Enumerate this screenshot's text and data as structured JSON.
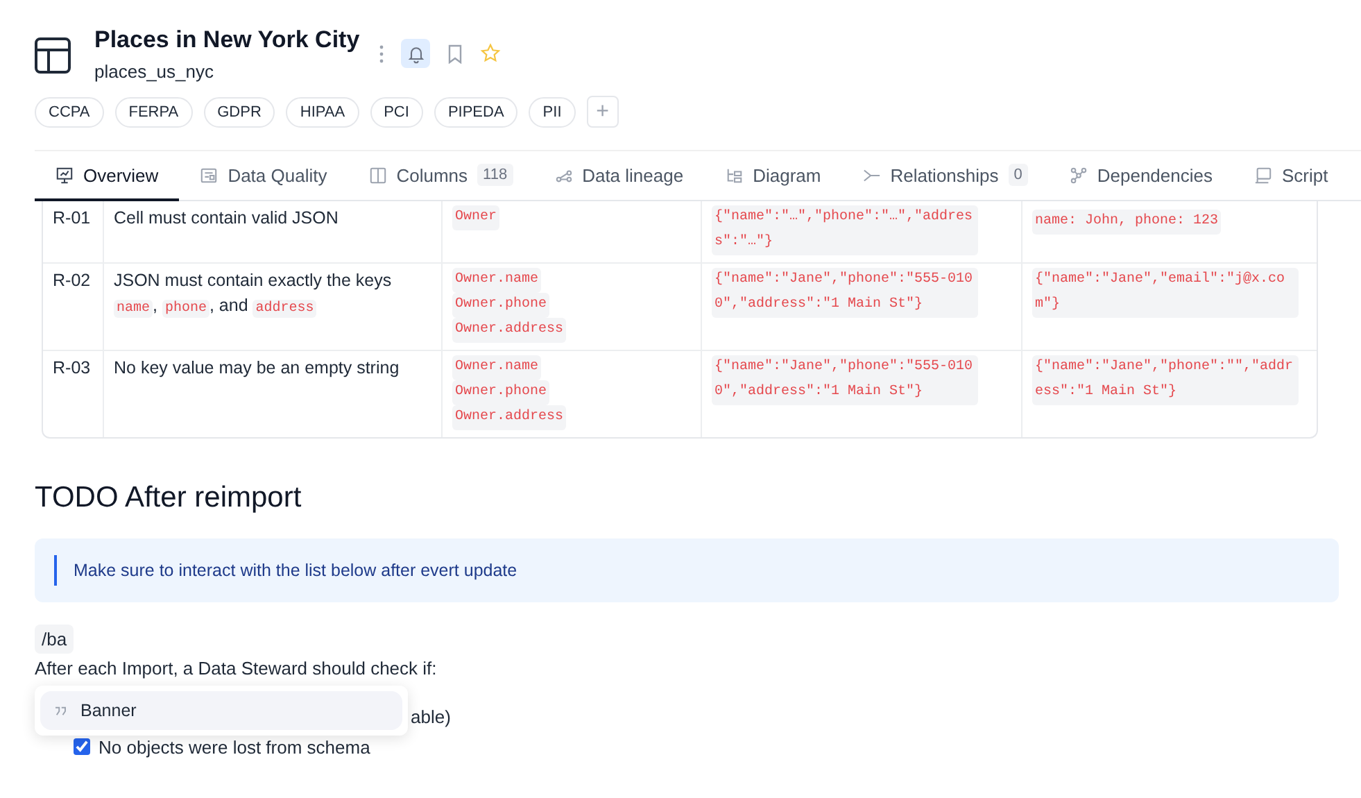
{
  "header": {
    "title": "Places in New York City",
    "subtitle": "places_us_nyc",
    "notify_on": true,
    "starred": false
  },
  "tags": [
    "CCPA",
    "FERPA",
    "GDPR",
    "HIPAA",
    "PCI",
    "PIPEDA",
    "PII"
  ],
  "add_tag": "+",
  "tabs": [
    {
      "label": "Overview",
      "selected": true
    },
    {
      "label": "Data Quality",
      "selected": false
    },
    {
      "label": "Columns",
      "count": "118",
      "selected": false
    },
    {
      "label": "Data lineage",
      "selected": false
    },
    {
      "label": "Diagram",
      "selected": false
    },
    {
      "label": "Relationships",
      "count": "0",
      "selected": false
    },
    {
      "label": "Dependencies",
      "selected": false
    },
    {
      "label": "Script",
      "selected": false
    }
  ],
  "rules_table": {
    "rows": [
      {
        "id": "R-01",
        "rule": [
          {
            "kind": "text",
            "text": "Cell must contain valid JSON"
          }
        ],
        "columns": [
          "Owner"
        ],
        "valid_example": "{\"name\":\"…\",\"phone\":\"…\",\"address\":\"…\"}",
        "invalid_example": "name: John, phone: 123"
      },
      {
        "id": "R-02",
        "rule": [
          {
            "kind": "text",
            "text": "JSON must contain exactly the keys "
          },
          {
            "kind": "code",
            "text": "name"
          },
          {
            "kind": "text",
            "text": ", "
          },
          {
            "kind": "code",
            "text": "phone"
          },
          {
            "kind": "text",
            "text": ", and "
          },
          {
            "kind": "code",
            "text": "address"
          }
        ],
        "columns": [
          "Owner.name",
          "Owner.phone",
          "Owner.address"
        ],
        "valid_example": "{\"name\":\"Jane\",\"phone\":\"555-0100\",\"address\":\"1 Main St\"}",
        "invalid_example": "{\"name\":\"Jane\",\"email\":\"j@x.com\"}"
      },
      {
        "id": "R-03",
        "rule": [
          {
            "kind": "text",
            "text": "No key value may be an empty string"
          }
        ],
        "columns": [
          "Owner.name",
          "Owner.phone",
          "Owner.address"
        ],
        "valid_example": "{\"name\":\"Jane\",\"phone\":\"555-0100\",\"address\":\"1 Main St\"}",
        "invalid_example": "{\"name\":\"Jane\",\"phone\":\"\",\"address\":\"1 Main St\"}"
      }
    ]
  },
  "section_heading": "TODO After reimport",
  "banner": "Make sure to interact with the list below after evert update",
  "slash_input": "/ba",
  "intro": "After each Import, a Data Steward should check if:",
  "checklist": [
    {
      "kind": "covered",
      "text": "able)"
    },
    {
      "kind": "checkbox",
      "text": "No objects were lost from schema",
      "checked": true
    }
  ],
  "slash_menu": {
    "items": [
      {
        "label": "Banner",
        "selected": true
      }
    ]
  }
}
